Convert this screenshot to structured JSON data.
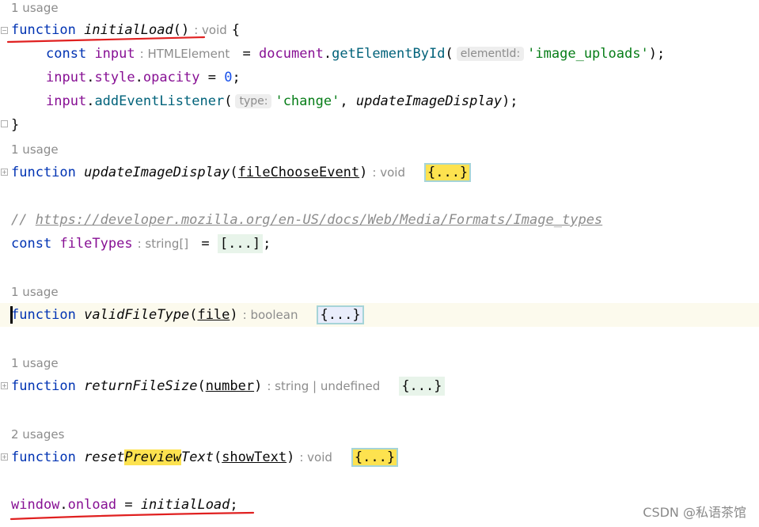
{
  "code": {
    "usage_1": "1 usage",
    "usage_2": "1 usage",
    "usage_3": "1 usage",
    "usage_4": "1 usage",
    "usage_5": "2 usages",
    "kw_function": "function",
    "kw_const": "const",
    "initial_load": {
      "name": "initialLoad",
      "parens": "()",
      "return_hint": ": void",
      "open_brace": "{",
      "close_brace": "}"
    },
    "line_input_const": {
      "var": "input",
      "type_hint": ": HTMLElement",
      "eq": " = ",
      "obj": "document",
      "dot": ".",
      "method": "getElementById",
      "open": "(",
      "param_hint": "elementId:",
      "arg": "'image_uploads'",
      "close": ");"
    },
    "line_opacity": {
      "var": "input",
      "dot1": ".",
      "prop1": "style",
      "dot2": ".",
      "prop2": "opacity",
      "eq": " = ",
      "value": "0",
      "end": ";"
    },
    "line_listener": {
      "var": "input",
      "dot": ".",
      "method": "addEventListener",
      "open": "(",
      "param_hint": "type:",
      "arg1": "'change'",
      "comma": ", ",
      "arg2": "updateImageDisplay",
      "close": ");"
    },
    "update_display": {
      "name": "updateImageDisplay",
      "open": "(",
      "param": "fileChooseEvent",
      "close": ")",
      "return_hint": ": void",
      "folded": "{...}"
    },
    "comment": {
      "prefix": "// ",
      "url": "https://developer.mozilla.org/en-US/docs/Web/Media/Formats/Image_types"
    },
    "file_types": {
      "name": "fileTypes",
      "type_hint": ": string[]",
      "eq": " = ",
      "folded": "[...]",
      "end": ";"
    },
    "valid_file_type": {
      "name": "validFileType",
      "open": "(",
      "param": "file",
      "close": ")",
      "return_hint": ": boolean",
      "folded": "{...}"
    },
    "return_file_size": {
      "name": "returnFileSize",
      "open": "(",
      "param": "number",
      "close": ")",
      "return_hint": ": string | undefined",
      "folded": "{...}"
    },
    "reset_preview": {
      "name_part1": "reset",
      "name_part2": "Preview",
      "name_part3": "Text",
      "open": "(",
      "param": "showText",
      "close": ")",
      "return_hint": ": void",
      "folded": "{...}"
    },
    "onload": {
      "obj": "window",
      "dot": ".",
      "prop": "onload",
      "eq": " = ",
      "value": "initialLoad",
      "end": ";"
    }
  },
  "watermark": "CSDN @私语茶馆",
  "colors": {
    "keyword": "#0033b3",
    "field": "#871094",
    "method": "#00627a",
    "string": "#067d17",
    "annotation_red": "#e02020"
  }
}
